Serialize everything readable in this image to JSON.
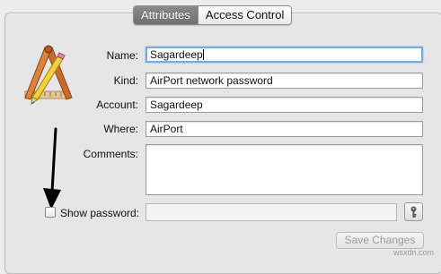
{
  "tabs": [
    {
      "label": "Attributes",
      "active": true
    },
    {
      "label": "Access Control",
      "active": false
    }
  ],
  "icons": {
    "app": "keychain-access-icon",
    "key": "key-icon",
    "annotation": "annotation-arrow"
  },
  "form": {
    "name_label": "Name:",
    "name_value": "Sagardeep",
    "kind_label": "Kind:",
    "kind_value": "AirPort network password",
    "account_label": "Account:",
    "account_value": "Sagardeep",
    "where_label": "Where:",
    "where_value": "AirPort",
    "comments_label": "Comments:",
    "comments_value": "",
    "show_password_label": "Show password:",
    "show_password_checked": false,
    "password_value": ""
  },
  "buttons": {
    "save_changes": "Save Changes"
  },
  "watermark": "wsxdn.com",
  "colors": {
    "focus": "#79a9dd",
    "active_tab": "#7a7a7a"
  }
}
